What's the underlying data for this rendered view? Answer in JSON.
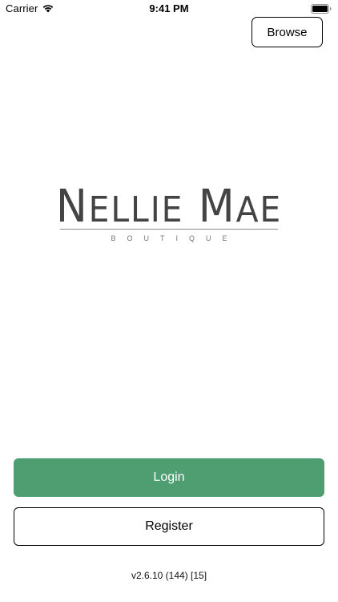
{
  "status_bar": {
    "carrier": "Carrier",
    "time": "9:41 PM",
    "wifi_icon": "wifi-icon",
    "battery_icon": "battery-icon"
  },
  "header": {
    "browse_label": "Browse"
  },
  "logo": {
    "name_first_cap": "N",
    "name_first_rest": "ELLIE",
    "name_second_cap": "M",
    "name_second_rest": "AE",
    "subtitle": "BOUTIQUE"
  },
  "actions": {
    "login_label": "Login",
    "register_label": "Register"
  },
  "footer": {
    "version": "v2.6.10 (144) [15]"
  },
  "colors": {
    "login_bg": "#4f9e72",
    "login_text": "#ffffff",
    "border": "#000000",
    "logo_text": "#444444"
  }
}
